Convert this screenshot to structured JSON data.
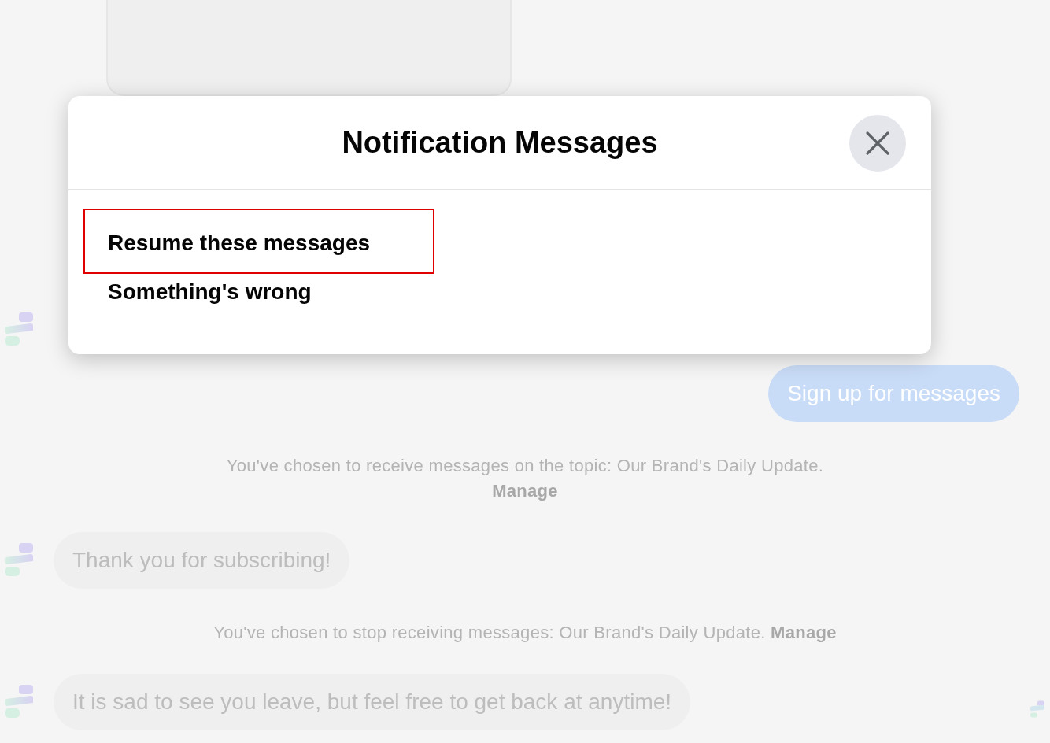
{
  "chat": [
    {
      "kind": "bot_hidden"
    },
    {
      "kind": "user",
      "text": "Sign up for messages"
    },
    {
      "kind": "notice",
      "text": "You've chosen to receive messages on the topic: Our Brand's Daily Update.",
      "link": "Manage"
    },
    {
      "kind": "bot",
      "text": "Thank you for subscribing!"
    },
    {
      "kind": "notice",
      "text": "You've chosen to stop receiving messages: Our Brand's Daily Update.",
      "link": "Manage"
    },
    {
      "kind": "bot",
      "text": "It is sad to see you leave, but feel free to get back at anytime!"
    }
  ],
  "dialog": {
    "title": "Notification Messages",
    "options": [
      {
        "label": "Resume these messages",
        "selected": true
      },
      {
        "label": "Something's wrong",
        "selected": false
      }
    ]
  }
}
